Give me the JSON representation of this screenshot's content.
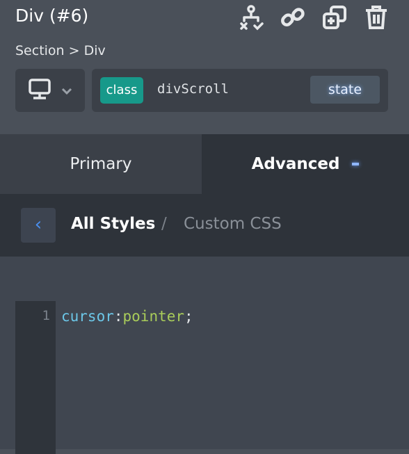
{
  "header": {
    "title": "Div (#6)",
    "icons": [
      "hierarchy-icon",
      "link-icon",
      "duplicate-icon",
      "trash-icon"
    ],
    "breadcrumb": "Section > Div"
  },
  "selector": {
    "device_icon": "desktop-icon",
    "badge": "class",
    "class_name": "divScroll",
    "state_label": "state"
  },
  "tabs": [
    {
      "label": "Primary"
    },
    {
      "label": "Advanced"
    }
  ],
  "subnav": {
    "back_icon": "chevron-left-icon",
    "current": "All Styles",
    "separator": "/",
    "other": "Custom CSS"
  },
  "editor": {
    "line_number": "1",
    "property": "cursor",
    "colon": ":",
    "value": "pointer",
    "semicolon": ";"
  },
  "colors": {
    "accent": "#17998a",
    "link": "#4a90f0"
  }
}
